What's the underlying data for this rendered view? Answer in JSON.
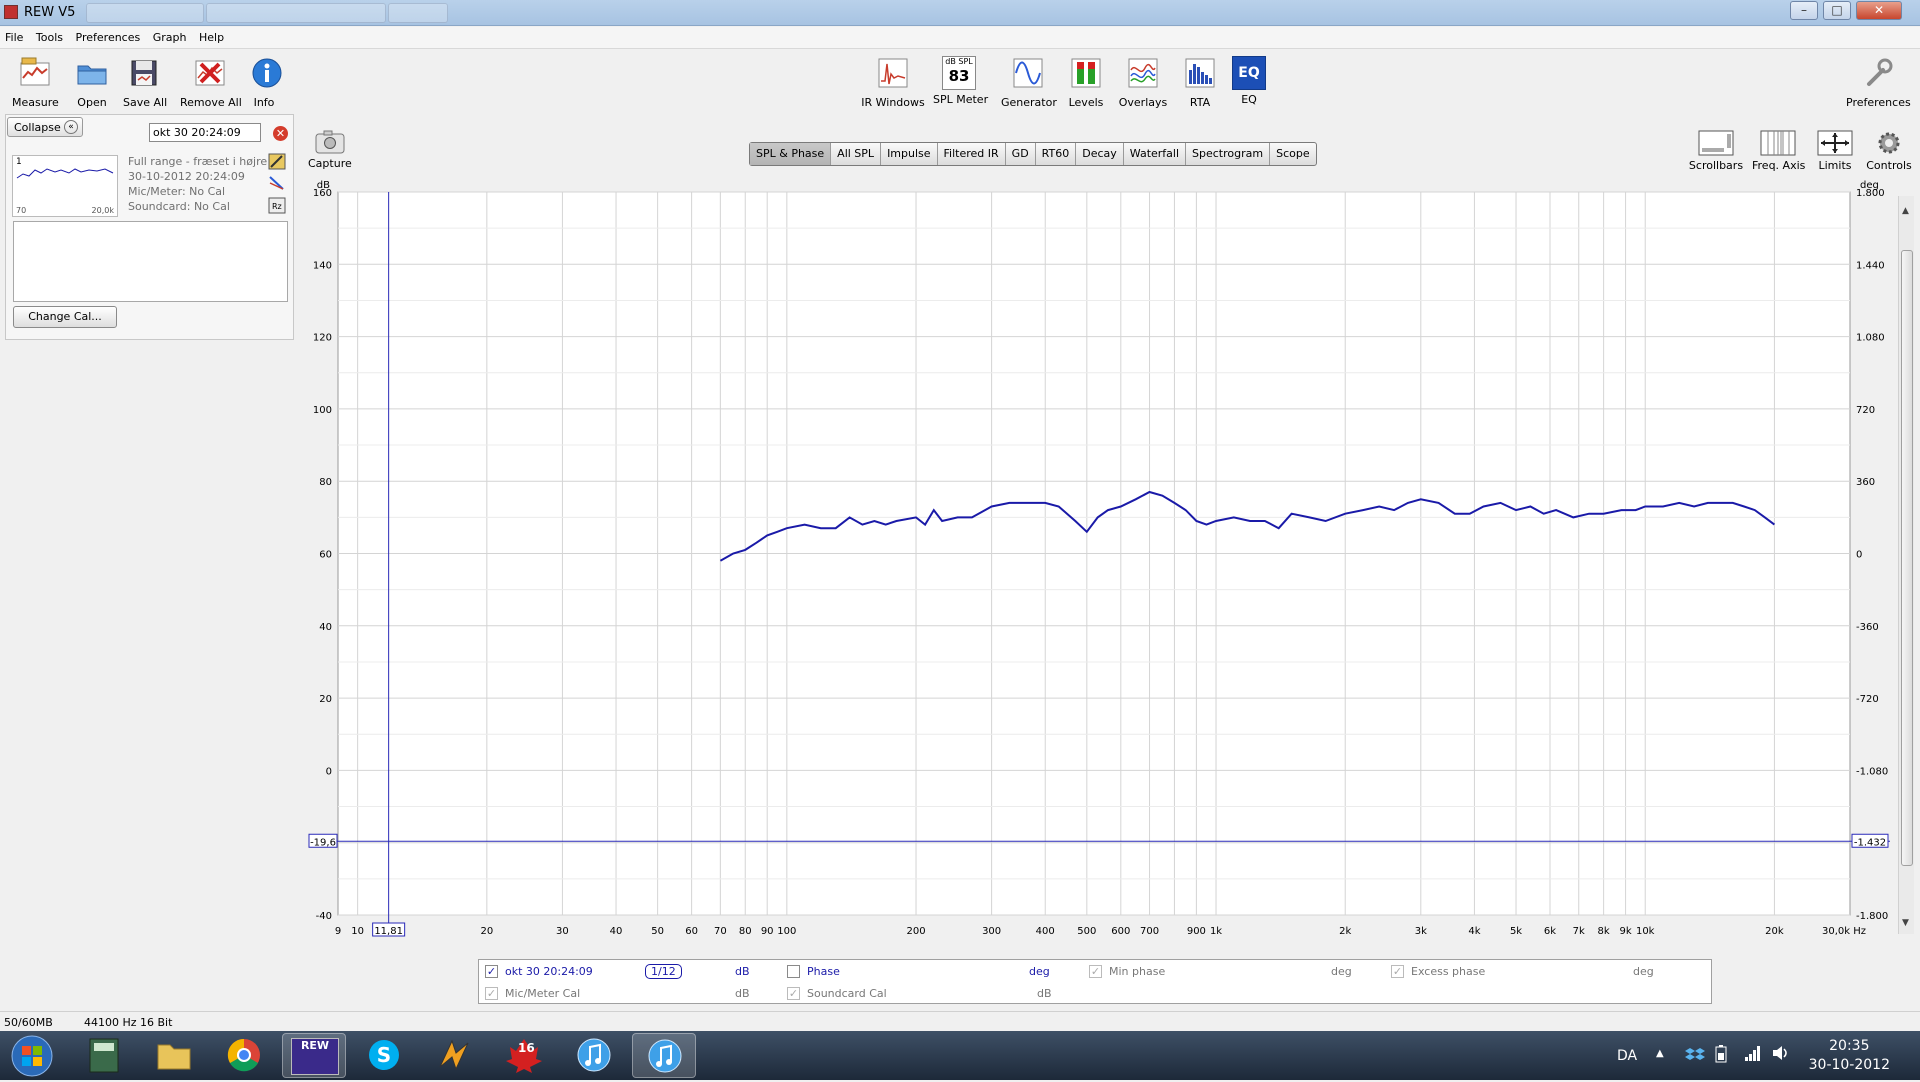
{
  "window": {
    "title": "REW V5"
  },
  "menu": [
    "File",
    "Tools",
    "Preferences",
    "Graph",
    "Help"
  ],
  "toolbar": {
    "left": [
      "Measure",
      "Open",
      "Save All",
      "Remove All",
      "Info"
    ],
    "center": [
      "IR Windows",
      "SPL Meter",
      "Generator",
      "Levels",
      "Overlays",
      "RTA",
      "EQ"
    ],
    "spl_meter_badge_top": "dB SPL",
    "spl_meter_badge_value": "83",
    "eq_badge": "EQ",
    "right": "Preferences"
  },
  "left_panel": {
    "collapse_label": "Collapse",
    "measurement_name": "okt 30 20:24:09",
    "thumb_index": "1",
    "thumb_min": "70",
    "thumb_max": "20,0k",
    "info": {
      "name": "Full range - fræset i højre",
      "date": "30-10-2012 20:24:09",
      "mic": "Mic/Meter: No Cal",
      "soundcard": "Soundcard: No Cal"
    },
    "change_cal_label": "Change Cal..."
  },
  "capture_label": "Capture",
  "tabs": [
    "SPL & Phase",
    "All SPL",
    "Impulse",
    "Filtered IR",
    "GD",
    "RT60",
    "Decay",
    "Waterfall",
    "Spectrogram",
    "Scope"
  ],
  "active_tab": "SPL & Phase",
  "right_tools": [
    "Scrollbars",
    "Freq. Axis",
    "Limits",
    "Controls"
  ],
  "graph": {
    "left_unit": "dB",
    "right_unit": "deg",
    "y_ticks": [
      "160",
      "140",
      "120",
      "100",
      "80",
      "60",
      "40",
      "20",
      "0",
      "-20",
      "-40"
    ],
    "y_right_ticks": [
      "1.800",
      "1.440",
      "1.080",
      "720",
      "360",
      "0",
      "-360",
      "-720",
      "-1.080",
      "-1.440",
      "-1.800"
    ],
    "x_ticks": [
      "9",
      "10",
      "20",
      "30",
      "40",
      "50",
      "60",
      "70",
      "80",
      "90",
      "100",
      "200",
      "300",
      "400",
      "500",
      "600",
      "700",
      "900",
      "1k",
      "2k",
      "3k",
      "4k",
      "5k",
      "6k",
      "7k",
      "8k",
      "9k",
      "10k",
      "20k",
      "30,0k Hz"
    ],
    "cursor_x_label": "11,81",
    "cursor_y_label": "-19,6",
    "cursor_y_right_label": "-1.432"
  },
  "chart_data": {
    "type": "line",
    "xlabel": "Hz",
    "ylabel": "dB",
    "xscale": "log",
    "xlim": [
      9,
      30000
    ],
    "ylim": [
      -40,
      160
    ],
    "y2lim": [
      -1800,
      1800
    ],
    "series": [
      {
        "name": "okt 30 20:24:09",
        "color": "#1a1aa8",
        "x": [
          70,
          75,
          80,
          85,
          90,
          95,
          100,
          110,
          120,
          130,
          140,
          150,
          160,
          170,
          180,
          200,
          210,
          220,
          230,
          250,
          270,
          300,
          330,
          360,
          400,
          430,
          470,
          500,
          530,
          560,
          600,
          650,
          700,
          750,
          800,
          850,
          900,
          950,
          1000,
          1100,
          1200,
          1300,
          1400,
          1500,
          1650,
          1800,
          2000,
          2200,
          2400,
          2600,
          2800,
          3000,
          3300,
          3600,
          3900,
          4200,
          4600,
          5000,
          5400,
          5800,
          6200,
          6800,
          7400,
          8000,
          8800,
          9500,
          10000,
          11000,
          12000,
          13000,
          14000,
          15000,
          16000,
          17000,
          18000,
          19000,
          20000
        ],
        "y": [
          58,
          60,
          61,
          63,
          65,
          66,
          67,
          68,
          67,
          67,
          70,
          68,
          69,
          68,
          69,
          70,
          68,
          72,
          69,
          70,
          70,
          73,
          74,
          74,
          74,
          73,
          69,
          66,
          70,
          72,
          73,
          75,
          77,
          76,
          74,
          72,
          69,
          68,
          69,
          70,
          69,
          69,
          67,
          71,
          70,
          69,
          71,
          72,
          73,
          72,
          74,
          75,
          74,
          71,
          71,
          73,
          74,
          72,
          73,
          71,
          72,
          70,
          71,
          71,
          72,
          72,
          73,
          73,
          74,
          73,
          74,
          74,
          74,
          73,
          72,
          70,
          68
        ]
      }
    ],
    "cursor": {
      "x": 11.81,
      "y": -19.6,
      "y_right": -1432
    },
    "grid": true
  },
  "legend": {
    "row1": [
      {
        "label": "okt 30 20:24:09",
        "checked": true,
        "smoothing": "1/12",
        "unit": "dB"
      },
      {
        "label": "Phase",
        "checked": false,
        "unit": "deg"
      },
      {
        "label": "Min phase",
        "checked": true,
        "unit": "deg"
      },
      {
        "label": "Excess phase",
        "checked": true,
        "unit": "deg"
      }
    ],
    "row2": [
      {
        "label": "Mic/Meter Cal",
        "checked": true,
        "unit": "dB"
      },
      {
        "label": "Soundcard Cal",
        "checked": true,
        "unit": "dB"
      }
    ]
  },
  "status": {
    "memory": "50/60MB",
    "sample_rate": "44100 Hz",
    "bits": "16 Bit"
  },
  "taskbar": {
    "lang": "DA",
    "time": "20:35",
    "date": "30-10-2012",
    "rew_badge": "REW",
    "calendar_badge": "16"
  },
  "colors": {
    "trace": "#1a1aa8",
    "cursor": "#2a2ab8",
    "grid": "#cfcfcf"
  }
}
